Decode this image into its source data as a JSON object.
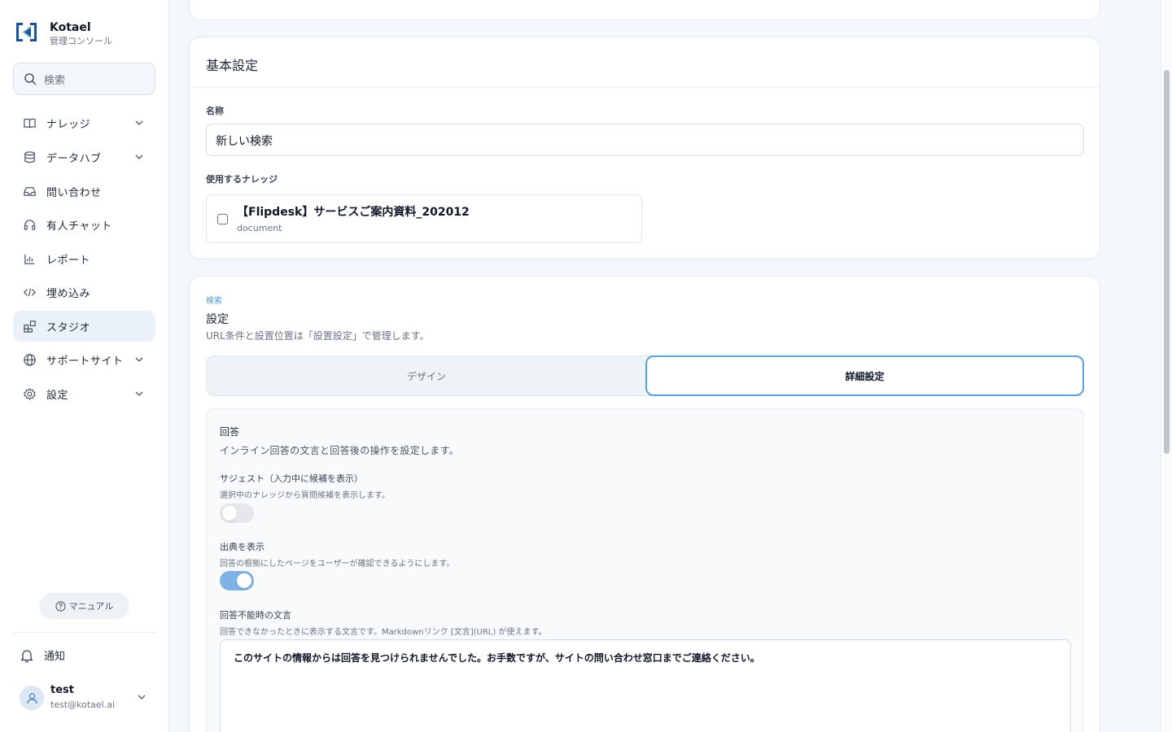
{
  "brand": {
    "name": "Kotael",
    "subtitle": "管理コンソール",
    "color": "#1d4f91"
  },
  "sidebar": {
    "search_placeholder": "検索",
    "items": [
      {
        "label": "ナレッジ",
        "icon": "book-icon",
        "has_chevron": true
      },
      {
        "label": "データハブ",
        "icon": "database-icon",
        "has_chevron": true
      },
      {
        "label": "問い合わせ",
        "icon": "inbox-icon",
        "has_chevron": false
      },
      {
        "label": "有人チャット",
        "icon": "headset-icon",
        "has_chevron": false
      },
      {
        "label": "レポート",
        "icon": "bar-chart-icon",
        "has_chevron": false
      },
      {
        "label": "埋め込み",
        "icon": "code-icon",
        "has_chevron": false
      },
      {
        "label": "スタジオ",
        "icon": "blocks-icon",
        "has_chevron": false,
        "active": true
      },
      {
        "label": "サポートサイト",
        "icon": "globe-icon",
        "has_chevron": true
      },
      {
        "label": "設定",
        "icon": "gear-icon",
        "has_chevron": true
      }
    ],
    "manual_label": "マニュアル",
    "notifications_label": "通知",
    "user": {
      "name": "test",
      "email": "test@kotael.ai"
    }
  },
  "basic": {
    "header": "基本設定",
    "name_label": "名称",
    "name_value": "新しい検索",
    "knowledge_label": "使用するナレッジ",
    "knowledge_items": [
      {
        "title": "【Flipdesk】サービスご案内資料_202012",
        "type": "document",
        "checked": false
      }
    ]
  },
  "settings": {
    "eyebrow": "検索",
    "title": "設定",
    "description": "URL条件と設置位置は「設置設定」で管理します。",
    "tabs": [
      {
        "label": "デザイン",
        "active": false
      },
      {
        "label": "詳細設定",
        "active": true
      }
    ],
    "panel": {
      "title": "回答",
      "description": "インライン回答の文言と回答後の操作を設定します。",
      "suggest": {
        "label": "サジェスト（入力中に候補を表示）",
        "help": "選択中のナレッジから質問候補を表示します。",
        "enabled": false
      },
      "sources": {
        "label": "出典を表示",
        "help": "回答の根拠にしたページをユーザーが確認できるようにします。",
        "enabled": true
      },
      "fallback": {
        "label": "回答不能時の文言",
        "help": "回答できなかったときに表示する文言です。Markdownリンク [文言](URL) が使えます。",
        "value": "このサイトの情報からは回答を見つけられませんでした。お手数ですが、サイトの問い合わせ窓口までご連絡ください。"
      }
    }
  },
  "colors": {
    "accent": "#5aa0db",
    "toggle_on": "#7fb3e6",
    "active_nav_bg": "#eaf1f8"
  }
}
